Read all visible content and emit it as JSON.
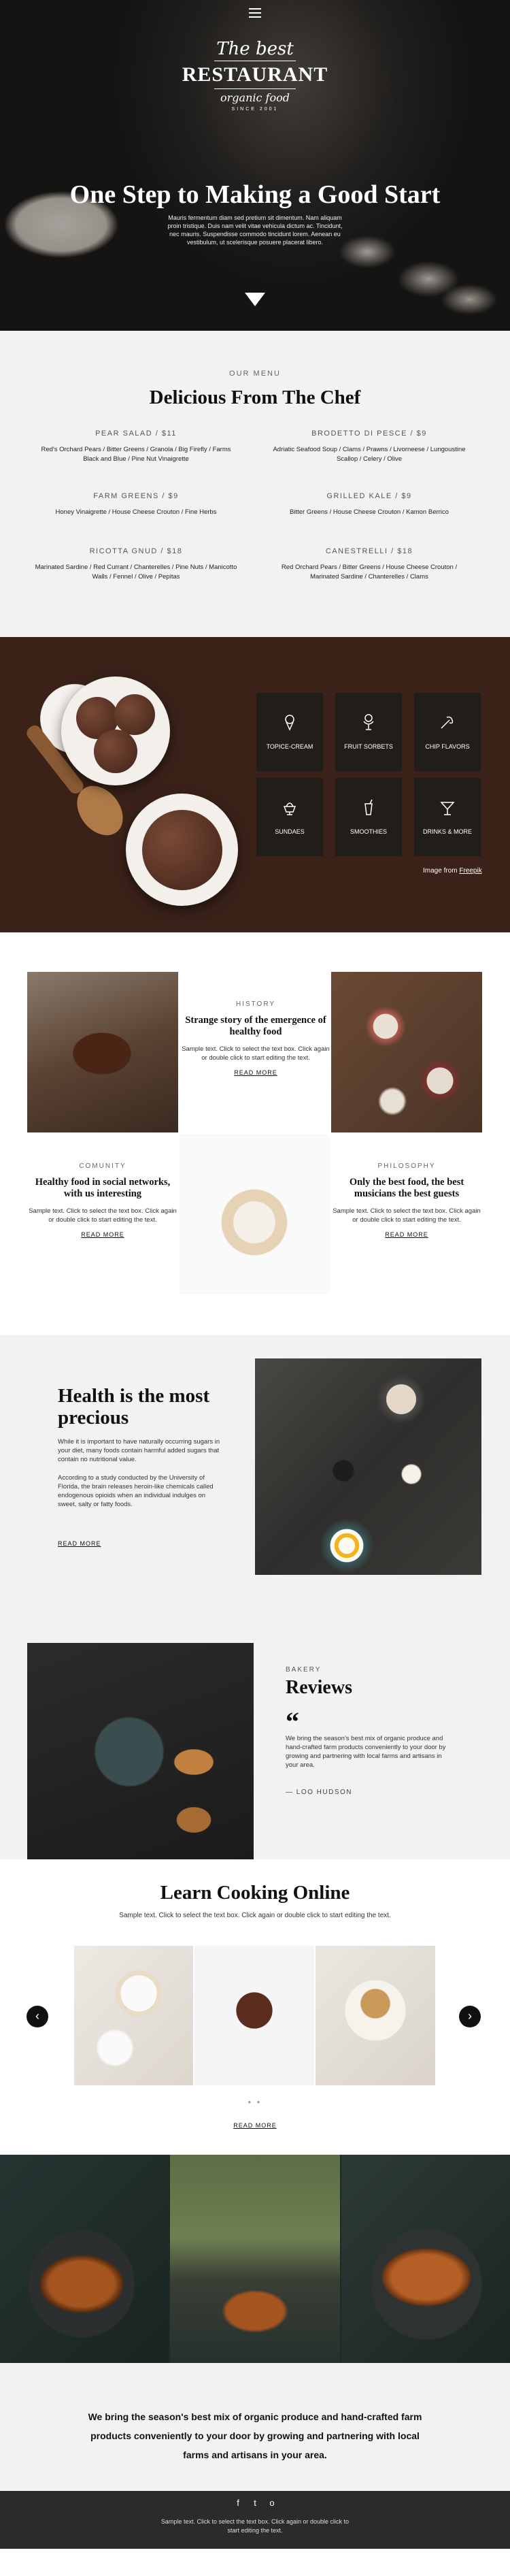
{
  "hero": {
    "logo": {
      "the_best": "The best",
      "restaurant": "RESTAURANT",
      "organic_food": "organic food",
      "since": "SINCE 2001"
    },
    "title": "One Step to Making a Good Start",
    "text": "Mauris fermentum diam sed pretium sit dimentum. Nam aliquam proin tristique. Duis nam velit vitae vehicula dictum ac. Tincidunt, nec mauris. Suspendisse commodo tincidunt lorem. Aenean eu vestibulum, ut scelerisque posuere placerat libero."
  },
  "menu": {
    "eyebrow": "OUR MENU",
    "title": "Delicious From The Chef",
    "dishes": [
      {
        "name": "PEAR SALAD / $11",
        "desc": "Red's Orchard Pears / Bitter Greens / Granola / Big Firefly / Farms Black and Blue / Pine Nut Vinaigrette"
      },
      {
        "name": "BRODETTO DI PESCE / $9",
        "desc": "Adriatic Seafood Soup / Clams / Prawns / Livorneese / Lungoustine Scallop / Celery / Olive"
      },
      {
        "name": "FARM GREENS / $9",
        "desc": "Honey Vinaigrette / House Cheese Crouton / Fine Herbs"
      },
      {
        "name": "GRILLED KALE / $9",
        "desc": "Bitter Greens / House Cheese Crouton / Kamon Berrico"
      },
      {
        "name": "RICOTTA GNUD / $18",
        "desc": "Marinated Sardine / Red Currant / Chanterelles / Pine Nuts / Manicotto Walls / Fennel / Olive / Pepitas"
      },
      {
        "name": "CANESTRELLI / $18",
        "desc": "Red Orchard Pears / Bitter Greens / House Cheese Crouton / Marinated Sardine / Chanterelles / Clams"
      }
    ]
  },
  "categories": {
    "tiles": [
      {
        "label": "TOPICE-CREAM",
        "icon": "ice-cream-icon"
      },
      {
        "label": "FRUIT SORBETS",
        "icon": "sorbet-glass-icon"
      },
      {
        "label": "CHIP FLAVORS",
        "icon": "chip-cone-icon"
      },
      {
        "label": "SUNDAES",
        "icon": "sundae-icon"
      },
      {
        "label": "SMOOTHIES",
        "icon": "smoothie-icon"
      },
      {
        "label": "DRINKS & MORE",
        "icon": "cocktail-icon"
      }
    ],
    "credit_prefix": "Image from ",
    "credit_link": "Freepik"
  },
  "grid": {
    "cards": [
      {
        "kicker": "HISTORY",
        "title": "Strange story of the emergence of healthy food",
        "text": "Sample text. Click to select the text box. Click again or double click to start editing the text.",
        "link": "READ MORE"
      },
      {
        "kicker": "COMUNITY",
        "title": "Healthy food in social networks, with us interesting",
        "text": "Sample text. Click to select the text box. Click again or double click to start editing the text.",
        "link": "READ MORE"
      },
      {
        "kicker": "PHILOSOPHY",
        "title": "Only the best food, the best musicians the best guests",
        "text": "Sample text. Click to select the text box. Click again or double click to start editing the text.",
        "link": "READ MORE"
      }
    ]
  },
  "health": {
    "title": "Health is the most precious",
    "p1": "While it is important to have naturally occurring sugars in your diet, many foods contain harmful added sugars that contain no nutritional value.",
    "p2": "According to a study conducted by the University of Florida, the brain releases heroin-like chemicals called endogenous opioids when an individual indulges on sweet, salty or fatty foods.",
    "link": "READ MORE"
  },
  "reviews": {
    "kicker": "BAKERY",
    "title": "Reviews",
    "quote_mark": "“",
    "text": "We bring the season's best mix of organic produce and hand-crafted farm products conveniently to your door by growing and partnering with local farms and artisans in your area.",
    "author": "— LOO HUDSON"
  },
  "cooking": {
    "title": "Learn Cooking Online",
    "subtitle": "Sample text. Click to select the text box. Click again or double click to start editing the text.",
    "prev": "‹",
    "next": "›",
    "link": "READ MORE"
  },
  "band": {
    "text": "We bring the season's best mix of organic produce and hand-crafted farm products conveniently to your door by growing and partnering with local farms and artisans in your area."
  },
  "footer": {
    "social": [
      "f",
      "t",
      "o"
    ],
    "text": "Sample text. Click to select the text box. Click again or double click to start editing the text."
  }
}
